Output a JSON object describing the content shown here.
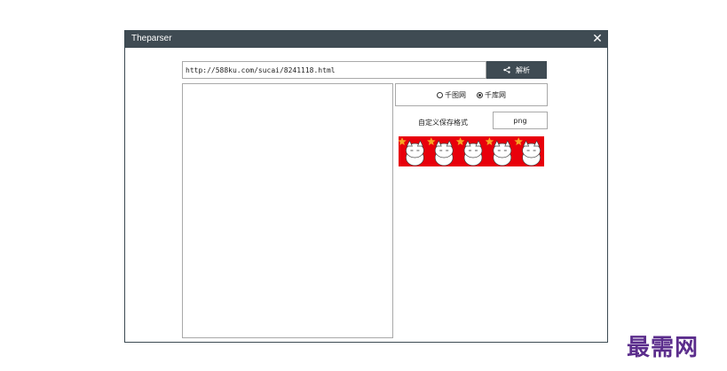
{
  "window": {
    "title": "Theparser",
    "close_glyph": "✕",
    "close_icon": "close-icon"
  },
  "url_bar": {
    "value": "http://588ku.com/sucai/8241118.html"
  },
  "parse_button": {
    "label": "解析",
    "icon": "share-icon"
  },
  "source_options": [
    {
      "label": "千图网",
      "selected": false
    },
    {
      "label": "千库网",
      "selected": true
    }
  ],
  "save_format": {
    "label": "自定义保存格式",
    "value": "png"
  },
  "preview_banner": {
    "background_color": "#e8000b",
    "star_color": "#f5a623",
    "character_count": 5
  },
  "watermark": {
    "text": "最需网",
    "color": "#5b2d8c"
  }
}
